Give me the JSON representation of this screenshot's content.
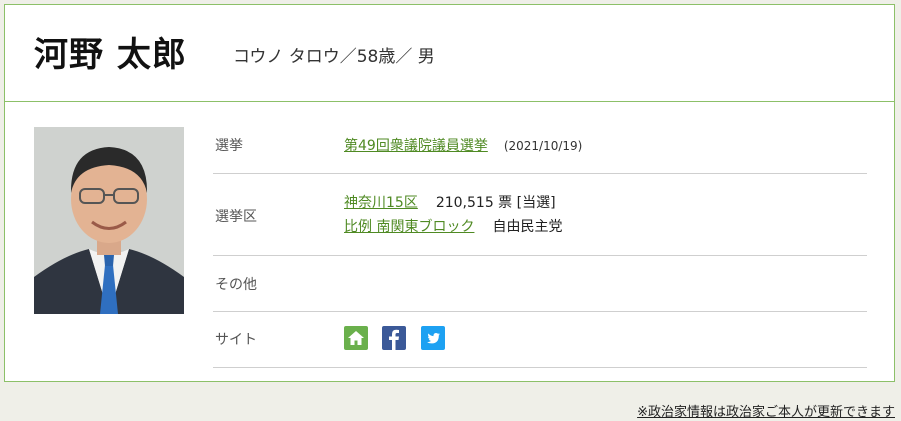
{
  "profile": {
    "name": "河野 太郎",
    "kana_age_gender": "コウノ タロウ／58歳／ 男"
  },
  "rows": {
    "election": {
      "label": "選挙",
      "link": "第49回衆議院議員選挙",
      "date": "(2021/10/19)"
    },
    "district": {
      "label": "選挙区",
      "district_link": "神奈川15区",
      "votes": "210,515 票 [当選]",
      "pr_link": "比例 南関東ブロック",
      "party": "自由民主党"
    },
    "other": {
      "label": "その他"
    },
    "site": {
      "label": "サイト"
    }
  },
  "footer": {
    "note": "※政治家情報は政治家ご本人が更新できます"
  },
  "colors": {
    "accent_green": "#8cc068",
    "link_green": "#4f8a23",
    "home_green": "#6ab04c",
    "facebook": "#3b5998",
    "twitter": "#1da1f2"
  }
}
